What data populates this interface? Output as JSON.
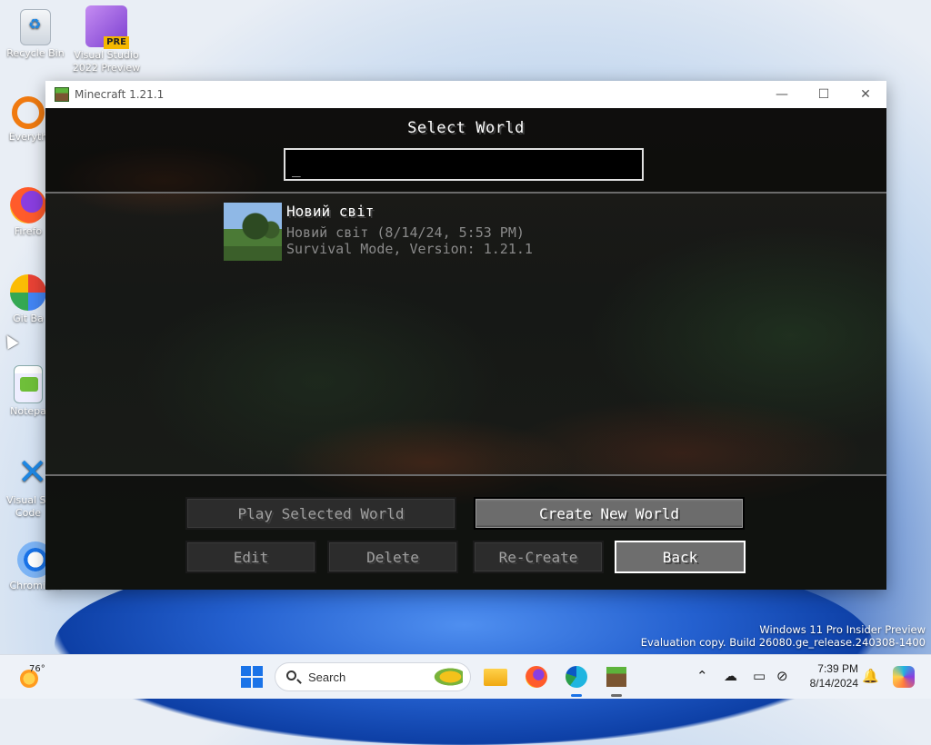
{
  "desktop": {
    "icons": [
      {
        "label": "Recycle Bin"
      },
      {
        "label": "Visual Studio 2022 Preview",
        "badge": "PRE"
      },
      {
        "label": "Everyth"
      },
      {
        "label": "Firefo"
      },
      {
        "label": "Git Ba"
      },
      {
        "label": "Notepa"
      },
      {
        "label": "Visual St Code"
      },
      {
        "label": "Chromium"
      }
    ],
    "watermark_line1": "Windows 11 Pro Insider Preview",
    "watermark_line2": "Evaluation copy. Build 26080.ge_release.240308-1400"
  },
  "window": {
    "title": "Minecraft 1.21.1",
    "minimize": "—",
    "maximize": "☐",
    "close": "✕"
  },
  "minecraft": {
    "screen_title": "Select World",
    "search_value": "_",
    "worlds": [
      {
        "name": "Новий світ",
        "detail": "Новий світ (8/14/24, 5:53 PM)",
        "mode": "Survival Mode, Version: 1.21.1"
      }
    ],
    "buttons": {
      "play": "Play Selected World",
      "create": "Create New World",
      "edit": "Edit",
      "delete": "Delete",
      "recreate": "Re-Create",
      "back": "Back"
    }
  },
  "taskbar": {
    "weather_temp": "76°",
    "search_label": "Search",
    "time": "7:39 PM",
    "date": "8/14/2024"
  }
}
